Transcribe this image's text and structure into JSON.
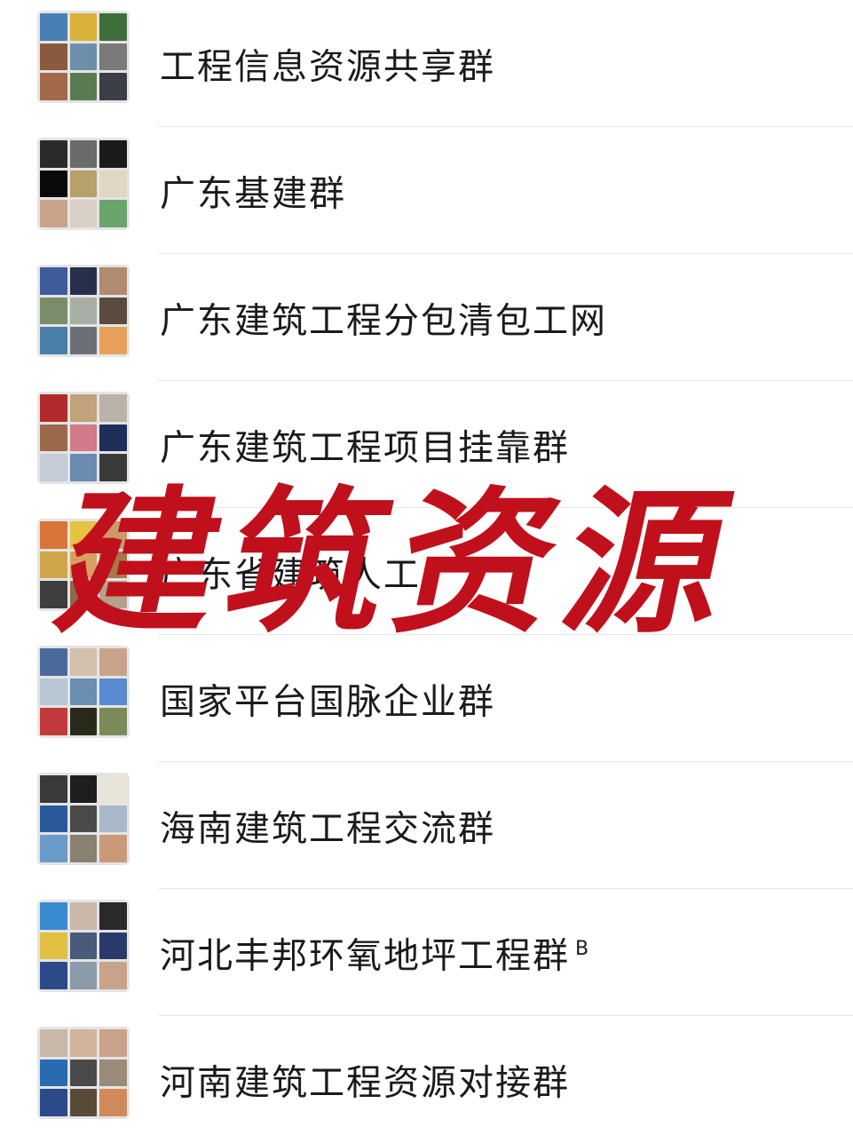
{
  "groups": [
    {
      "name": "工程信息资源共享群",
      "suffix": "",
      "avatar_colors": [
        "#4a7fb5",
        "#d9b23a",
        "#3f6e3a",
        "#8a5a3c",
        "#6d8ea8",
        "#7c7a78",
        "#a3694a",
        "#5a7b52",
        "#3b3e46"
      ]
    },
    {
      "name": "广东基建群",
      "suffix": "",
      "avatar_colors": [
        "#2b2b2b",
        "#6b6b6b",
        "#1b1b1b",
        "#0a0a0a",
        "#b8a06a",
        "#e0d6c4",
        "#c9a389",
        "#d8cfc6",
        "#6aa36c"
      ]
    },
    {
      "name": "广东建筑工程分包清包工网",
      "suffix": "",
      "avatar_colors": [
        "#3e5b9a",
        "#26304a",
        "#b28a70",
        "#7a8c6a",
        "#a8b0a3",
        "#5a4a40",
        "#4a7fa8",
        "#6d6f78",
        "#e6a05a"
      ]
    },
    {
      "name": "广东建筑工程项目挂靠群",
      "suffix": "",
      "avatar_colors": [
        "#b22a2a",
        "#c2a27a",
        "#b9b2a8",
        "#9c6a4a",
        "#d07a8a",
        "#1e2f5a",
        "#c4ccd6",
        "#6a8ab0",
        "#3a3a3a"
      ]
    },
    {
      "name": "广东省建筑人工",
      "suffix": "",
      "avatar_colors": [
        "#d8733a",
        "#e6c240",
        "#c99a6a",
        "#d0a64a",
        "#d8a060",
        "#a8784a",
        "#3e3e3e",
        "#8a6a4a",
        "#b2a28a"
      ]
    },
    {
      "name": "国家平台国脉企业群",
      "suffix": "",
      "avatar_colors": [
        "#4a6a9a",
        "#d2c0aa",
        "#c9a389",
        "#b8c6d4",
        "#6a8eb0",
        "#5a8ad0",
        "#c23a3a",
        "#2a2a1a",
        "#7a8a5a"
      ]
    },
    {
      "name": "海南建筑工程交流群",
      "suffix": "",
      "avatar_colors": [
        "#3a3a3a",
        "#1e1e1e",
        "#e8e4da",
        "#2a5a9a",
        "#4a4a4a",
        "#a8b8c8",
        "#6a9ac8",
        "#8a8070",
        "#c99a7a"
      ]
    },
    {
      "name": "河北丰邦环氧地坪工程群",
      "suffix": "B",
      "avatar_colors": [
        "#3a8ad0",
        "#c9b8a8",
        "#2a2a2a",
        "#e0c040",
        "#4a5a7a",
        "#2a3a6a",
        "#2a4a8a",
        "#8a9aa8",
        "#c9a389"
      ]
    },
    {
      "name": "河南建筑工程资源对接群",
      "suffix": "",
      "avatar_colors": [
        "#c8b8a8",
        "#d2b49a",
        "#c9a389",
        "#2a6ab0",
        "#4a4a4a",
        "#9a8a7a",
        "#2a4a8a",
        "#5a4a3a",
        "#d08a5a"
      ]
    }
  ],
  "watermark": "建筑资源"
}
